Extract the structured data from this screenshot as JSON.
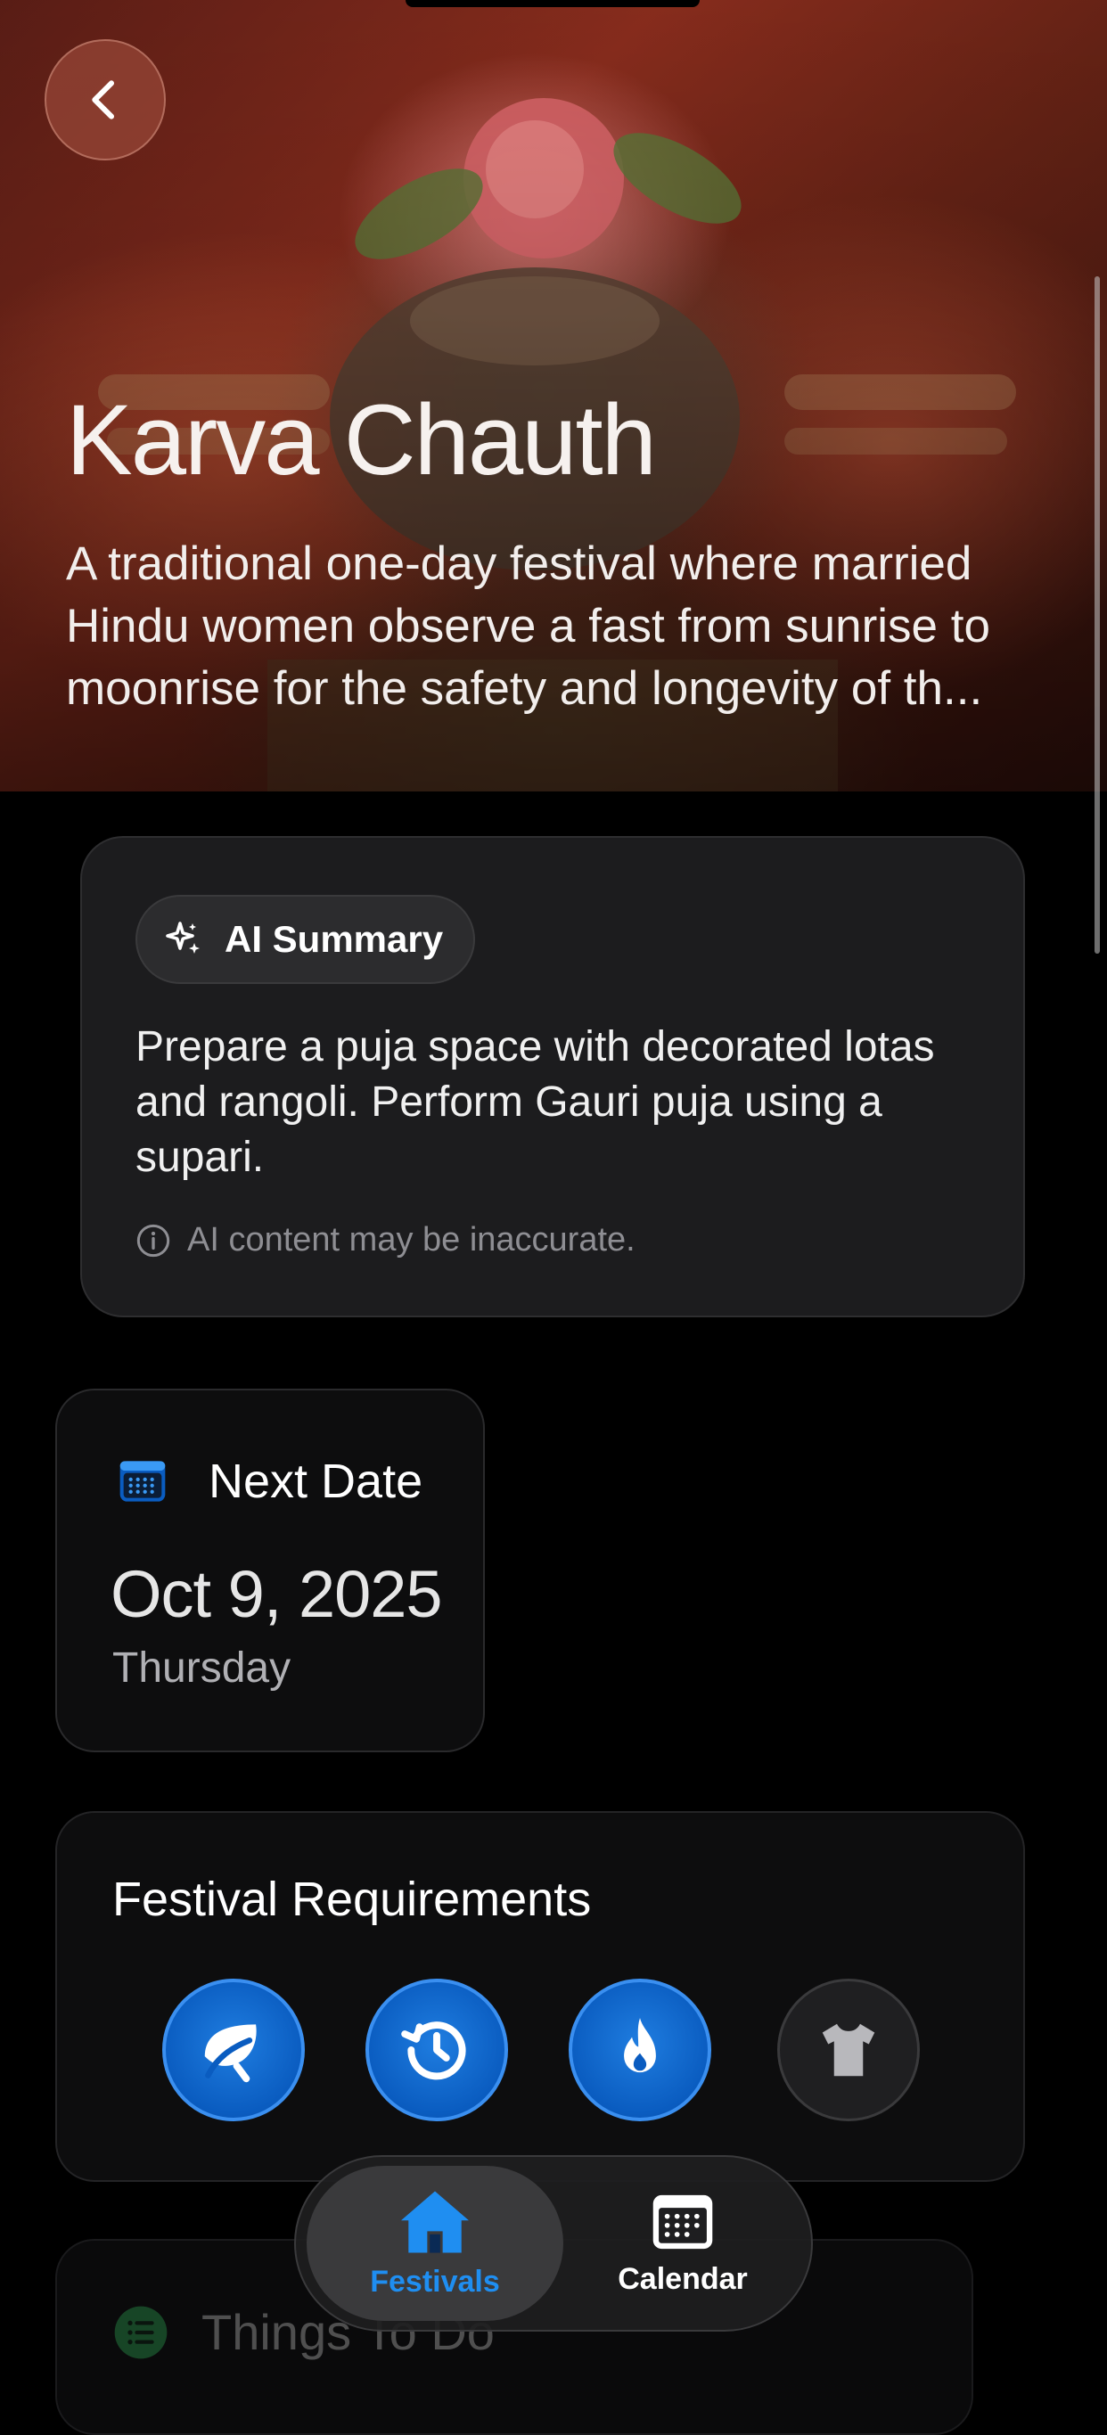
{
  "hero": {
    "title": "Karva Chauth",
    "description": "A traditional one-day festival where married Hindu women observe a fast from sunrise to moonrise for the safety and longevity of th..."
  },
  "nav": {
    "back_icon": "chevron-left-icon"
  },
  "ai_summary": {
    "chip_label": "AI Summary",
    "chip_icon": "sparkles-icon",
    "text": "Prepare a puja space with decorated lotas and rangoli. Perform Gauri puja using a supari.",
    "disclaimer": "AI content may be inaccurate.",
    "disclaimer_icon": "info-icon"
  },
  "next_date": {
    "label": "Next Date",
    "icon": "calendar-icon",
    "date": "Oct 9, 2025",
    "weekday": "Thursday"
  },
  "requirements": {
    "title": "Festival Requirements",
    "items": [
      {
        "icon": "leaf-icon",
        "active": true
      },
      {
        "icon": "history-clock-icon",
        "active": true
      },
      {
        "icon": "flame-icon",
        "active": true
      },
      {
        "icon": "tshirt-icon",
        "active": false
      }
    ]
  },
  "todo": {
    "label": "Things To Do",
    "icon": "list-icon"
  },
  "tabbar": {
    "tabs": [
      {
        "label": "Festivals",
        "icon": "house-icon",
        "active": true
      },
      {
        "label": "Calendar",
        "icon": "calendar-grid-icon",
        "active": false
      }
    ]
  },
  "colors": {
    "accent": "#1f7de0",
    "card_background": "#1c1c1e",
    "background": "#000000"
  }
}
